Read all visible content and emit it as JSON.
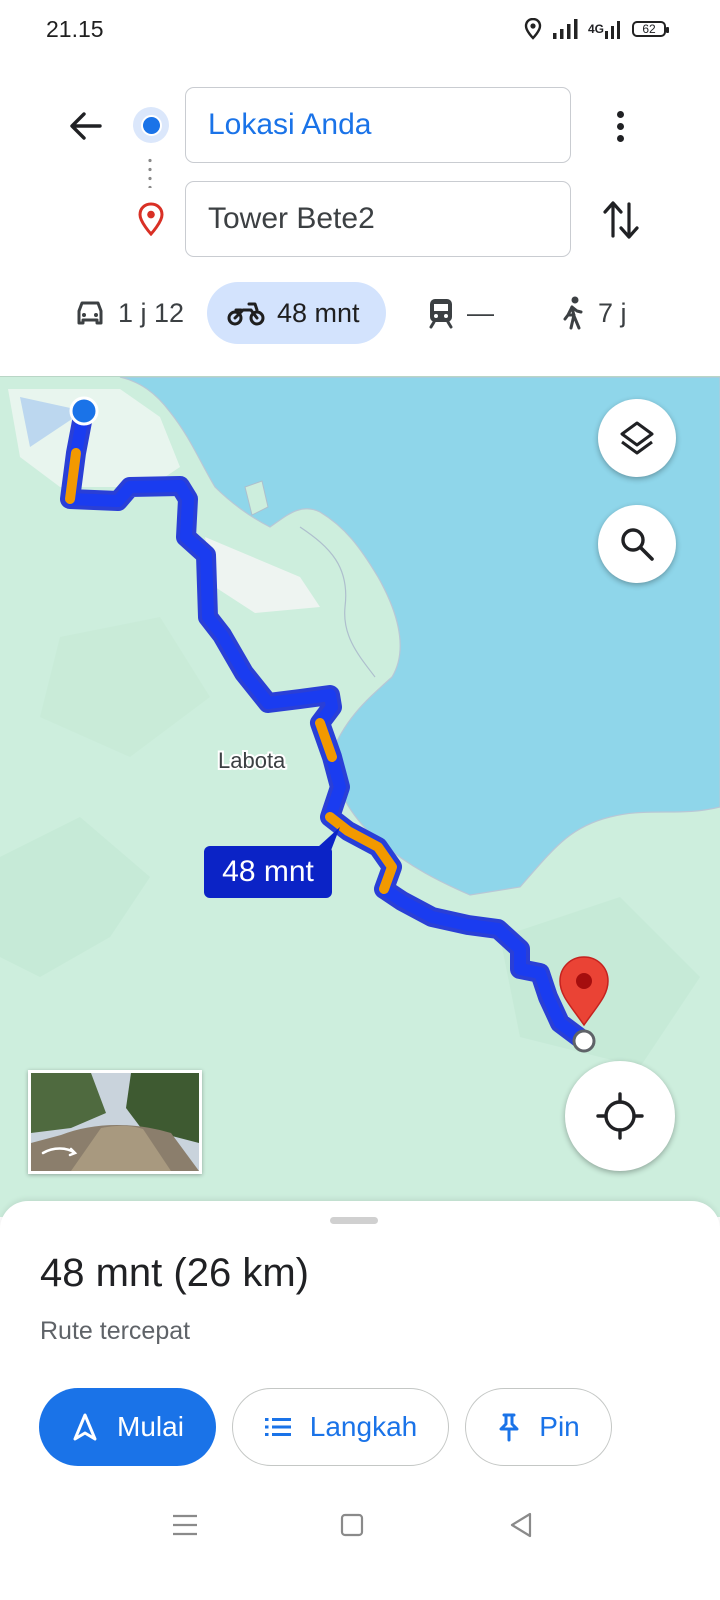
{
  "status_bar": {
    "time": "21.15",
    "network": "4G",
    "battery": "62"
  },
  "search": {
    "origin": "Lokasi Anda",
    "destination": "Tower Bete2"
  },
  "modes": [
    {
      "icon": "car-icon",
      "label": "1 j 12",
      "active": false
    },
    {
      "icon": "motorcycle-icon",
      "label": "48 mnt",
      "active": true
    },
    {
      "icon": "transit-icon",
      "label": "—",
      "active": false
    },
    {
      "icon": "walk-icon",
      "label": "7 j",
      "active": false
    }
  ],
  "map": {
    "place_label": "Labota",
    "route_time_chip": "48 mnt",
    "colors": {
      "water": "#8fd6ea",
      "land": "#cdeedd",
      "route": "#1a3cf0",
      "traffic": "#f29900",
      "pin": "#ea4335"
    }
  },
  "sheet": {
    "summary_time": "48 mnt",
    "summary_distance": "(26 km)",
    "subtitle": "Rute tercepat",
    "buttons": {
      "start": "Mulai",
      "steps": "Langkah",
      "pin": "Pin"
    }
  }
}
